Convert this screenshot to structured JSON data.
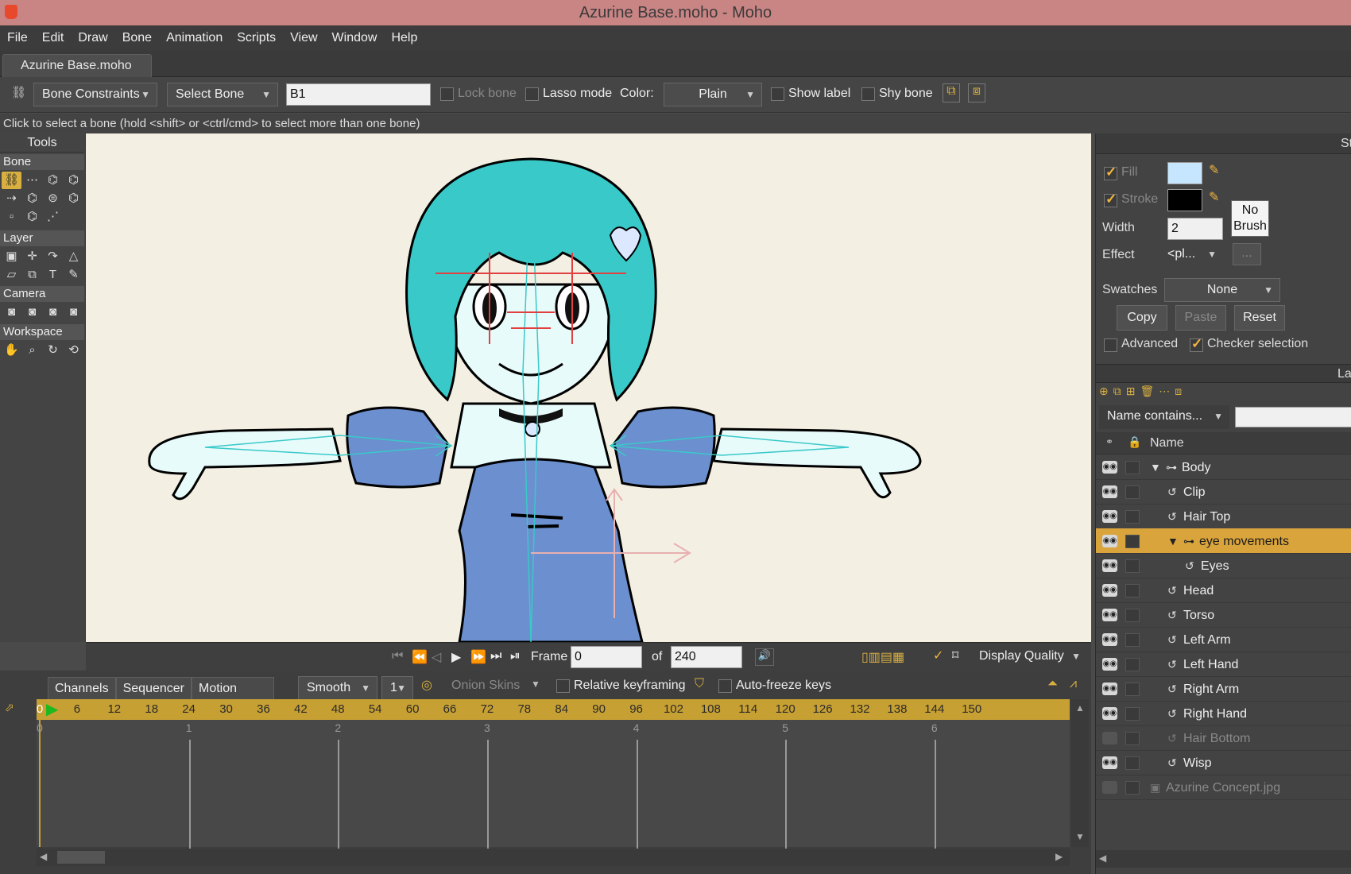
{
  "window": {
    "title": "Azurine Base.moho - Moho"
  },
  "menu": [
    "File",
    "Edit",
    "Draw",
    "Bone",
    "Animation",
    "Scripts",
    "View",
    "Window",
    "Help"
  ],
  "doc_tab": "Azurine Base.moho",
  "toolbar": {
    "constraints_label": "Bone Constraints",
    "select_bone_label": "Select Bone",
    "bone_name_value": "B1",
    "lock_bone": "Lock bone",
    "lasso_mode": "Lasso mode",
    "color_label": "Color:",
    "color_value": "Plain",
    "show_label": "Show label",
    "shy_bone": "Shy bone"
  },
  "hint": "Click to select a bone (hold <shift> or <ctrl/cmd> to select more than one bone)",
  "tools": {
    "title": "Tools",
    "groups": [
      "Bone",
      "Layer",
      "Camera",
      "Workspace"
    ]
  },
  "playback": {
    "frame_label": "Frame",
    "frame_value": "0",
    "of_label": "of",
    "total_value": "240",
    "display_quality": "Display Quality"
  },
  "timeline": {
    "tabs": [
      "Channels",
      "Sequencer",
      "Motion Graph"
    ],
    "interp": "Smooth",
    "step": "1",
    "onion_skins": "Onion Skins",
    "relative_keyframing": "Relative keyframing",
    "auto_freeze": "Auto-freeze keys",
    "ruler_ticks": [
      "0",
      "6",
      "12",
      "18",
      "24",
      "30",
      "36",
      "42",
      "48",
      "54",
      "60",
      "66",
      "72",
      "78",
      "84",
      "90",
      "96",
      "102",
      "108",
      "114",
      "120",
      "126",
      "132",
      "138",
      "144",
      "150"
    ],
    "second_marks": [
      "0",
      "1",
      "2",
      "3",
      "4",
      "5",
      "6"
    ]
  },
  "style_panel": {
    "fill": "Fill",
    "stroke": "Stroke",
    "width_label": "Width",
    "width_value": "2",
    "no_brush_1": "No",
    "no_brush_2": "Brush",
    "effect_label": "Effect",
    "effect_value": "<pl...",
    "effect_btn": "...",
    "swatches_label": "Swatches",
    "swatches_value": "None",
    "copy": "Copy",
    "paste": "Paste",
    "reset": "Reset",
    "advanced": "Advanced",
    "checker_selection": "Checker selection",
    "fill_color": "#c6e6ff",
    "stroke_color": "#000000",
    "panel_tab_st": "St",
    "panel_tab_la": "La"
  },
  "layers_panel": {
    "filter": "Name contains...",
    "name_header": "Name",
    "rows": [
      {
        "name": "Body",
        "indent": 0,
        "type": "bone",
        "expand": true,
        "sel": false,
        "dim": false
      },
      {
        "name": "Clip",
        "indent": 1,
        "type": "vector",
        "expand": false,
        "sel": false,
        "dim": false
      },
      {
        "name": "Hair Top",
        "indent": 1,
        "type": "vector",
        "expand": false,
        "sel": false,
        "dim": false
      },
      {
        "name": "eye movements",
        "indent": 1,
        "type": "bone",
        "expand": true,
        "sel": true,
        "dim": false
      },
      {
        "name": "Eyes",
        "indent": 2,
        "type": "vector",
        "expand": false,
        "sel": false,
        "dim": false
      },
      {
        "name": "Head",
        "indent": 1,
        "type": "vector",
        "expand": false,
        "sel": false,
        "dim": false
      },
      {
        "name": "Torso",
        "indent": 1,
        "type": "vector",
        "expand": false,
        "sel": false,
        "dim": false
      },
      {
        "name": "Left Arm",
        "indent": 1,
        "type": "vector",
        "expand": false,
        "sel": false,
        "dim": false
      },
      {
        "name": "Left Hand",
        "indent": 1,
        "type": "vector",
        "expand": false,
        "sel": false,
        "dim": false
      },
      {
        "name": "Right Arm",
        "indent": 1,
        "type": "vector",
        "expand": false,
        "sel": false,
        "dim": false
      },
      {
        "name": "Right Hand",
        "indent": 1,
        "type": "vector",
        "expand": false,
        "sel": false,
        "dim": false
      },
      {
        "name": "Hair Bottom",
        "indent": 1,
        "type": "vector",
        "expand": false,
        "sel": false,
        "dim": true
      },
      {
        "name": "Wisp",
        "indent": 1,
        "type": "vector",
        "expand": false,
        "sel": false,
        "dim": false
      },
      {
        "name": "Azurine Concept.jpg",
        "indent": 0,
        "type": "image",
        "expand": false,
        "sel": false,
        "dim": true
      }
    ]
  },
  "colors": {
    "accent": "#d9a43b",
    "titlebar": "#c98484",
    "ruler": "#c7a033"
  }
}
